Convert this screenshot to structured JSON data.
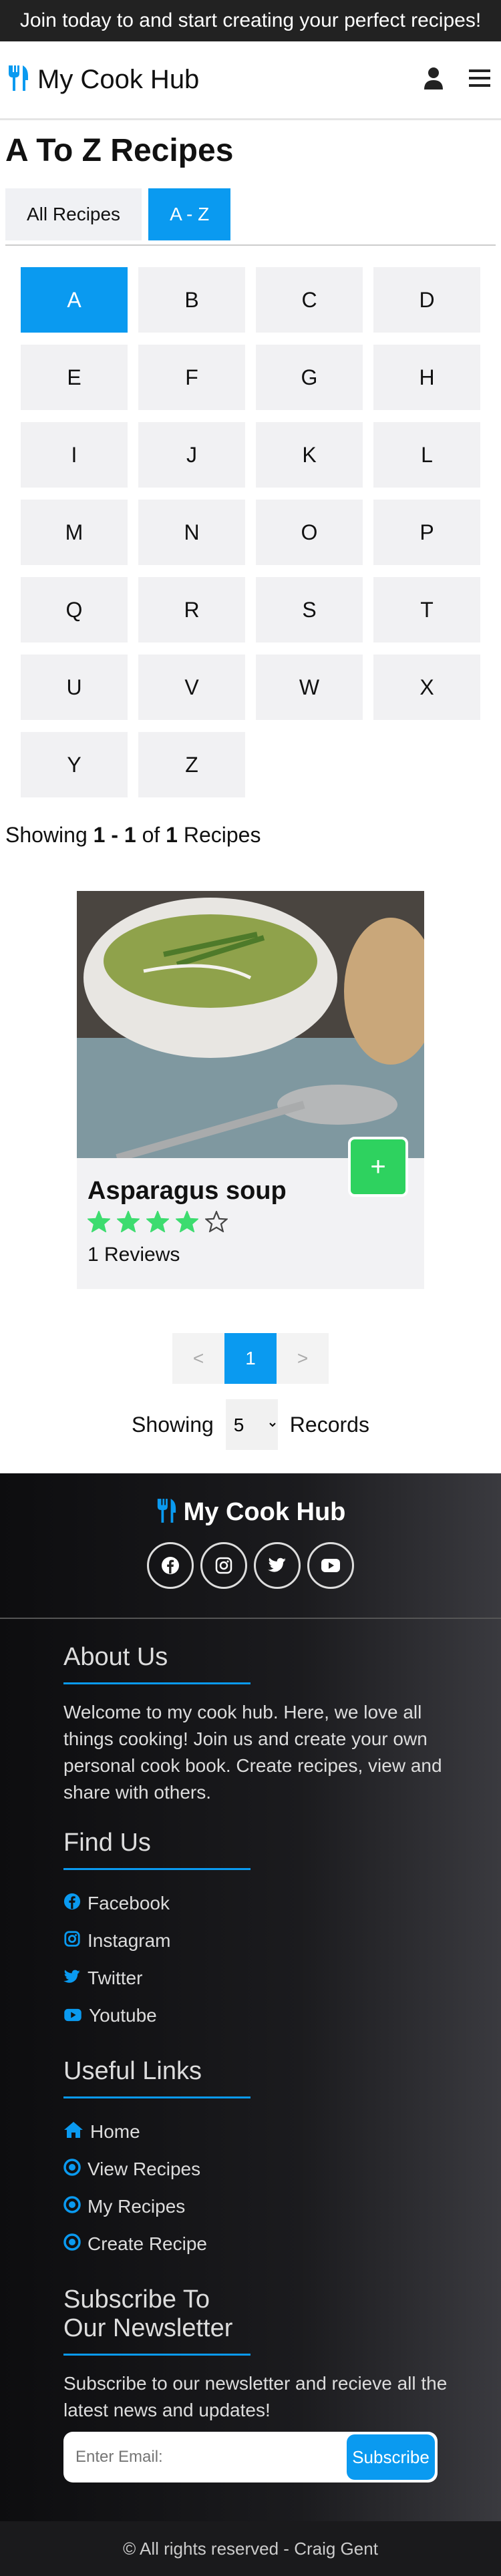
{
  "promo": {
    "text": "Join today to and start creating your perfect recipes!"
  },
  "navbar": {
    "brand": "My Cook Hub",
    "brand_icon": "utensils-icon",
    "user_icon": "user-icon",
    "menu_icon": "hamburger-icon"
  },
  "page": {
    "title": "A To Z Recipes"
  },
  "tabs": [
    {
      "label": "All Recipes",
      "active": false
    },
    {
      "label": "A - Z",
      "active": true
    }
  ],
  "letters": [
    "A",
    "B",
    "C",
    "D",
    "E",
    "F",
    "G",
    "H",
    "I",
    "J",
    "K",
    "L",
    "M",
    "N",
    "O",
    "P",
    "Q",
    "R",
    "S",
    "T",
    "U",
    "V",
    "W",
    "X",
    "Y",
    "Z"
  ],
  "active_letter": "A",
  "showing": {
    "prefix": "Showing",
    "from": "1",
    "dash": "-",
    "to": "1",
    "of": "of",
    "total": "1",
    "suffix": "Recipes"
  },
  "recipe": {
    "title": "Asparagus soup",
    "rating": 4,
    "max_rating": 5,
    "reviews": "1 Reviews",
    "add_label": "+"
  },
  "pagination": {
    "prev": "<",
    "current": "1",
    "next": ">"
  },
  "records": {
    "prefix": "Showing",
    "value": "5",
    "suffix": "Records"
  },
  "footer": {
    "brand": "My Cook Hub",
    "socials": [
      "facebook-icon",
      "instagram-icon",
      "twitter-icon",
      "youtube-icon"
    ],
    "about_title": "About Us",
    "about_text": "Welcome to my cook hub. Here, we love all things cooking! Join us and create your own personal cook book. Create recipes, view and share with others.",
    "find_title": "Find Us",
    "find_links": [
      "Facebook",
      "Instagram",
      "Twitter",
      "Youtube"
    ],
    "useful_title": "Useful Links",
    "useful_links": [
      "Home",
      "View Recipes",
      "My Recipes",
      "Create Recipe"
    ],
    "newsletter_title": "Subscribe To Our Newsletter",
    "newsletter_text": "Subscribe to our newsletter and recieve all the latest news and updates!",
    "email_placeholder": "Enter Email:",
    "subscribe_label": "Subscribe",
    "copyright": "© All rights reserved - Craig Gent"
  },
  "colors": {
    "accent": "#0a9af0",
    "add_green": "#2ed25f",
    "star_green": "#3ddc6f"
  }
}
